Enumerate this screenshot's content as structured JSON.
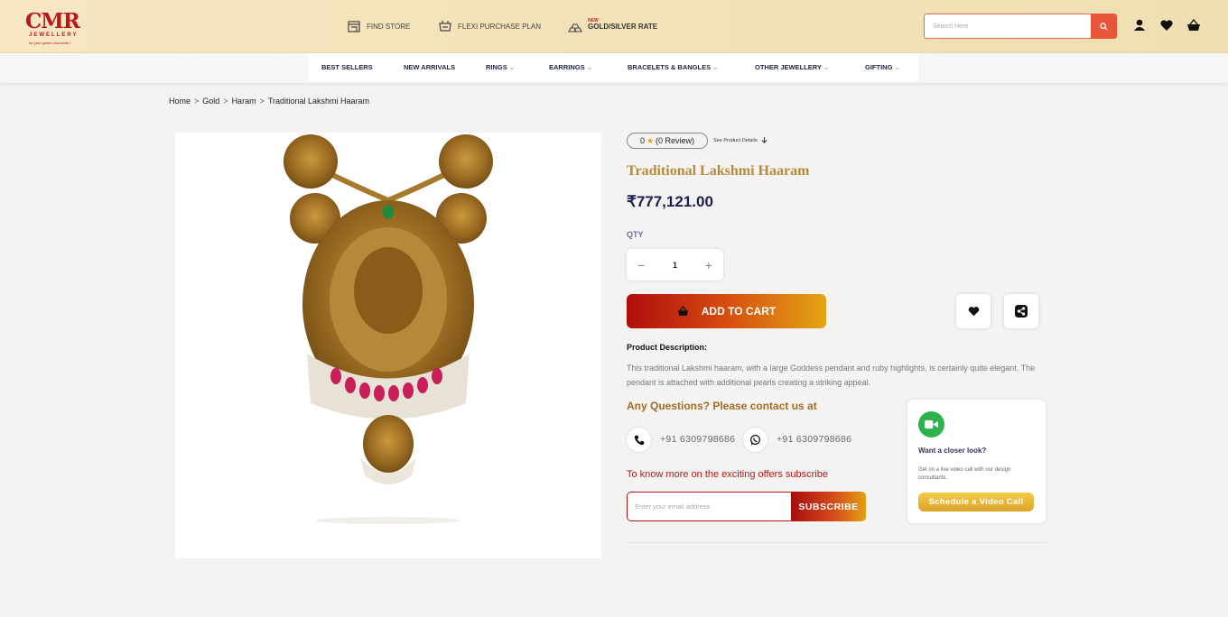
{
  "brand": {
    "logo_text": "CMR",
    "logo_sub": "JEWELLERY",
    "logo_tagline": "for your golden moments !"
  },
  "header": {
    "links": [
      {
        "label": "FIND STORE",
        "icon": "store-icon"
      },
      {
        "label": "FLEXI PURCHASE PLAN",
        "icon": "calendar-cart-icon"
      },
      {
        "label": "GOLD/SILVER RATE",
        "icon": "gold-bars-icon",
        "badge": "NEW"
      }
    ],
    "search": {
      "placeholder": "Search Here",
      "icon": "search-icon"
    },
    "icons": [
      "user-icon",
      "heart-icon",
      "basket-icon"
    ]
  },
  "nav": {
    "items": [
      {
        "label": "BEST SELLERS",
        "dropdown": false
      },
      {
        "label": "NEW ARRIVALS",
        "dropdown": false
      },
      {
        "label": "RINGS",
        "dropdown": true
      },
      {
        "label": "EARRINGS",
        "dropdown": true
      },
      {
        "label": "BRACELETS & BANGLES",
        "dropdown": true
      },
      {
        "label": "OTHER JEWELLERY",
        "dropdown": true
      },
      {
        "label": "GIFTING",
        "dropdown": true
      }
    ]
  },
  "breadcrumb": [
    "Home",
    "Gold",
    "Haram",
    "Traditional Lakshmi Haaram"
  ],
  "breadcrumb_separator": ">",
  "product": {
    "rating_value": "0",
    "rating_count": "(0 Review)",
    "see_details": "See Product Details",
    "title": "Traditional Lakshmi Haaram",
    "price": "₹777,121.00",
    "qty_label": "QTY",
    "qty_value": "1",
    "add_to_cart": "ADD TO CART",
    "description_title": "Product Description:",
    "description": "This traditional Lakshmi haaram, with a large Goddess pendant and ruby highlights, is certainly quite elegant. The pendant is attached with additional pearls creating a striking appeal."
  },
  "contact": {
    "heading": "Any Questions? Please contact us at",
    "phone": "+91 6309798686",
    "whatsapp": "+91 6309798686"
  },
  "subscribe": {
    "heading": "To know more on the exciting offers subscribe",
    "placeholder": "Enter your email address",
    "button": "SUBSCRIBE"
  },
  "video_call": {
    "title": "Want a closer look?",
    "text": "Get on a live video call with our design consultants.",
    "button": "Schedule a Video Call"
  },
  "colors": {
    "brand_red": "#b8171b",
    "title_gold": "#b48a3c",
    "price_navy": "#1c2050",
    "video_green": "#2eb24a"
  }
}
